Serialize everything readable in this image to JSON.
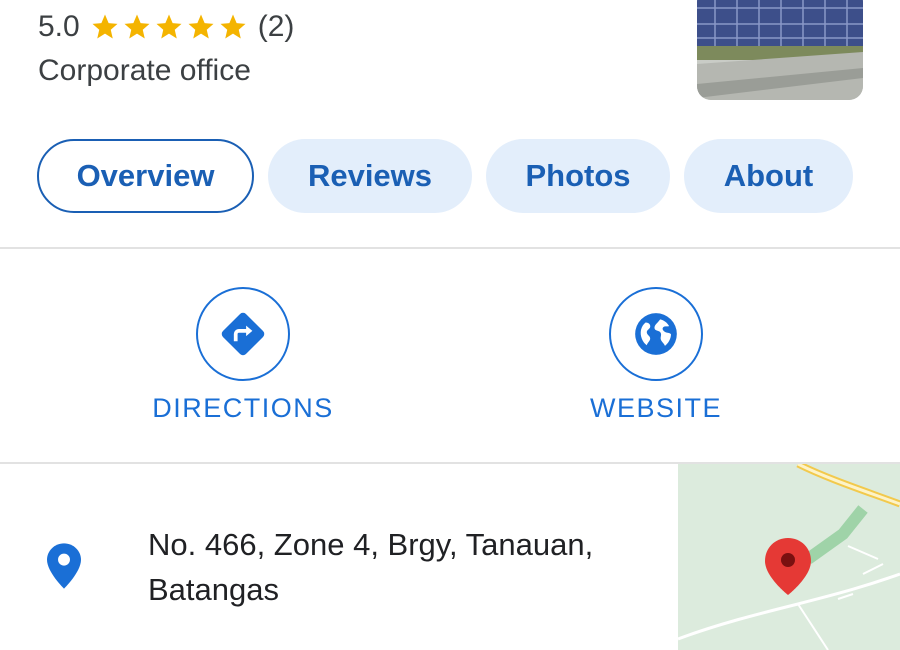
{
  "header": {
    "rating": "5.0",
    "stars_filled": 5,
    "review_count": "(2)",
    "category": "Corporate office"
  },
  "tabs": [
    {
      "label": "Overview",
      "active": true
    },
    {
      "label": "Reviews",
      "active": false
    },
    {
      "label": "Photos",
      "active": false
    },
    {
      "label": "About",
      "active": false
    }
  ],
  "actions": {
    "directions_label": "DIRECTIONS",
    "website_label": "WEBSITE"
  },
  "address": {
    "line1": "No. 466, Zone 4, Brgy, Tanauan,",
    "line2": "Batangas"
  },
  "colors": {
    "accent_blue": "#1a6fd6",
    "tab_bg": "#e3eefb",
    "star_yellow": "#f4b400",
    "map_pin_red": "#e53935"
  }
}
